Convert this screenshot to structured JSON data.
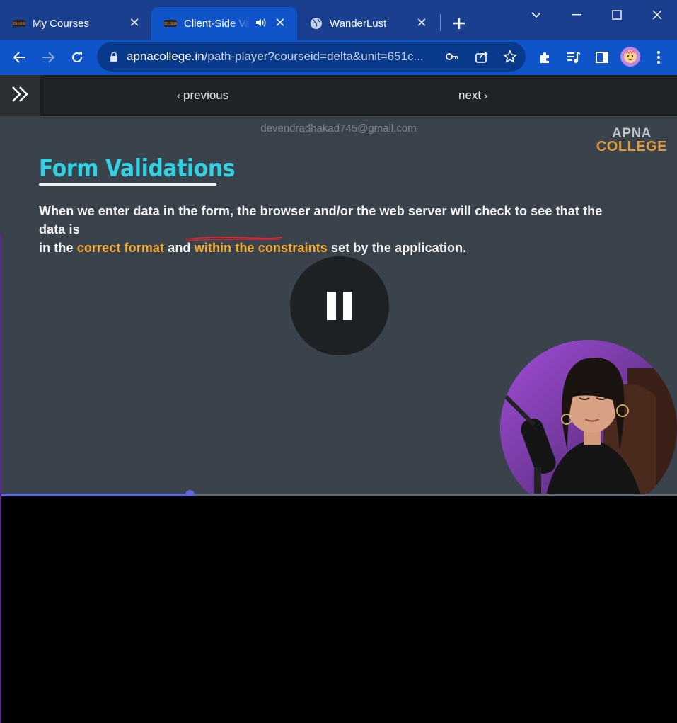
{
  "browser": {
    "tabs": [
      {
        "title": "My Courses",
        "favicon": "apna-college-favicon"
      },
      {
        "title": "Client-Side Validations",
        "favicon": "apna-college-favicon",
        "audio": true,
        "active": true
      },
      {
        "title": "WanderLust",
        "favicon": "globe-icon"
      }
    ],
    "url_domain": "apnacollege.in",
    "url_path": "/path-player?courseid=delta&unit=651c..."
  },
  "page_nav": {
    "previous_label": "previous",
    "next_label": "next"
  },
  "video": {
    "watermark": "devendradhakad745@gmail.com",
    "brand_line1": "APNA",
    "brand_line2": "COLLEGE",
    "slide_title": "Form Validations",
    "text_line1": "When we enter data in the form, the browser and/or the web server will check to see that the data is",
    "text_line2_a": "in the ",
    "text_line2_hl1": "correct format",
    "text_line2_b": " and ",
    "text_line2_hl2": "within the constraints",
    "text_line2_c": " set by the application.",
    "state": "playing",
    "progress_fraction": 0.28
  },
  "colors": {
    "tab_strip": "#1a3f8f",
    "toolbar": "#0f55c9",
    "video_bg": "#3a434b",
    "title_cyan": "#34d1e3",
    "highlight": "#f4a933",
    "progress": "#5b67d8"
  }
}
